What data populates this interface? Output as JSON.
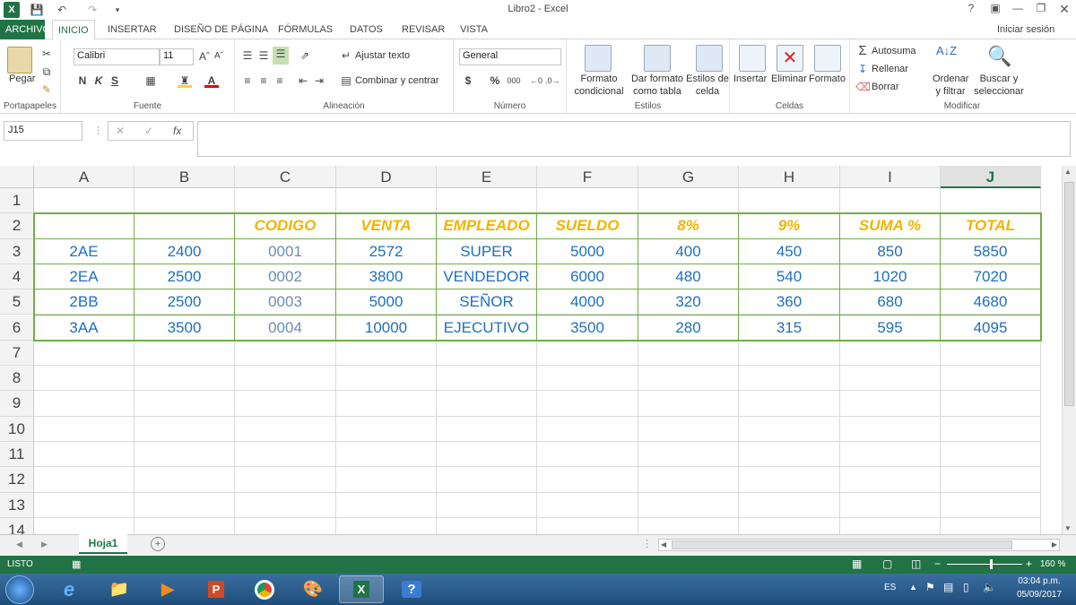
{
  "window": {
    "title": "Libro2 - Excel",
    "help": "?",
    "signin": "Iniciar sesión"
  },
  "tabs": [
    "ARCHIVO",
    "INICIO",
    "INSERTAR",
    "DISEÑO DE PÁGINA",
    "FÓRMULAS",
    "DATOS",
    "REVISAR",
    "VISTA"
  ],
  "ribbon": {
    "clipboard": {
      "paste": "Pegar",
      "label": "Portapapeles"
    },
    "font": {
      "name": "Calibri",
      "size": "11",
      "bold": "N",
      "italic": "K",
      "underline": "S",
      "label": "Fuente"
    },
    "alignment": {
      "wrap": "Ajustar texto",
      "merge": "Combinar y centrar",
      "label": "Alineación"
    },
    "number": {
      "format": "General",
      "currency": "$",
      "percent": "%",
      "thousands": "000",
      "label": "Número"
    },
    "styles": {
      "cond1": "Formato",
      "cond2": "condicional",
      "table1": "Dar formato",
      "table2": "como tabla",
      "cell1": "Estilos de",
      "cell2": "celda",
      "label": "Estilos"
    },
    "cells": {
      "insert": "Insertar",
      "delete": "Eliminar",
      "format": "Formato",
      "label": "Celdas"
    },
    "editing": {
      "autosum": "Autosuma",
      "fill": "Rellenar",
      "clear": "Borrar",
      "sort1": "Ordenar",
      "sort2": "y filtrar",
      "find1": "Buscar y",
      "find2": "seleccionar",
      "label": "Modificar"
    }
  },
  "formula_bar": {
    "name_box": "J15",
    "fx": "fx",
    "cancel": "✕",
    "enter": "✓",
    "value": ""
  },
  "columns": [
    "A",
    "B",
    "C",
    "D",
    "E",
    "F",
    "G",
    "H",
    "I",
    "J"
  ],
  "rows": [
    "1",
    "2",
    "3",
    "4",
    "5",
    "6",
    "7",
    "8",
    "9",
    "10",
    "11",
    "12",
    "13",
    "14"
  ],
  "selected_column": "J",
  "table": {
    "header": [
      "",
      "",
      "CODIGO",
      "VENTA",
      "EMPLEADO",
      "SUELDO",
      "8%",
      "9%",
      "SUMA %",
      "TOTAL"
    ],
    "data": [
      [
        "2AE",
        "2400",
        "0001",
        "2572",
        "SUPER",
        "5000",
        "400",
        "450",
        "850",
        "5850"
      ],
      [
        "2EA",
        "2500",
        "0002",
        "3800",
        "VENDEDOR",
        "6000",
        "480",
        "540",
        "1020",
        "7020"
      ],
      [
        "2BB",
        "2500",
        "0003",
        "5000",
        "SEÑOR",
        "4000",
        "320",
        "360",
        "680",
        "4680"
      ],
      [
        "3AA",
        "3500",
        "0004",
        "10000",
        "EJECUTIVO",
        "3500",
        "280",
        "315",
        "595",
        "4095"
      ]
    ]
  },
  "sheet": {
    "name": "Hoja1"
  },
  "status": {
    "ready": "LISTO",
    "zoom": "160 %"
  },
  "taskbar": {
    "lang": "ES",
    "time": "03:04 p.m.",
    "date": "05/09/2017"
  },
  "colors": {
    "excel_green": "#217346",
    "header_text": "#f0b400",
    "data_text": "#1f6fbf",
    "table_border": "#70ad47"
  }
}
